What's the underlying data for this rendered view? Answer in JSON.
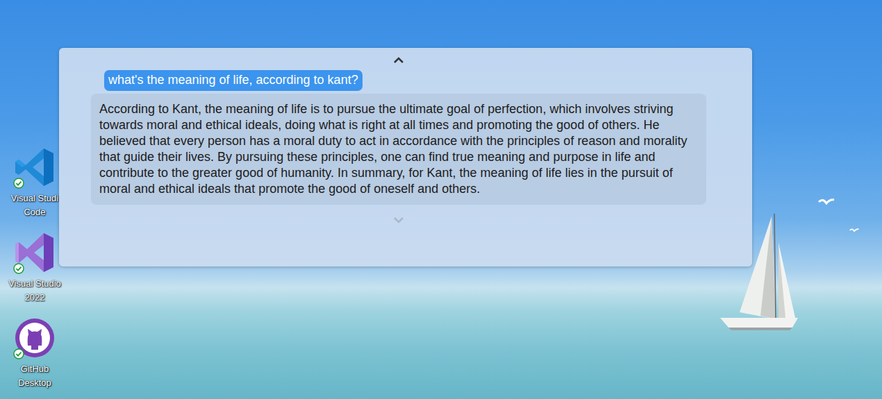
{
  "desktop_icons": [
    {
      "label": "Visual Studi Code",
      "synced": true
    },
    {
      "label": "Visual Studio 2022",
      "synced": true
    },
    {
      "label": "GitHub Desktop",
      "synced": true
    }
  ],
  "chat": {
    "messages": [
      {
        "kind": "user",
        "text": "what's the meaning of life, according to kant?"
      },
      {
        "kind": "assistant",
        "text": "According to Kant, the meaning of life is to pursue the ultimate goal of perfection, which involves striving towards moral and ethical ideals, doing what is right at all times and promoting the good of others. He believed that every person has a moral duty to act in accordance with the principles of reason and morality that guide their lives. By pursuing these principles, one can find true meaning and purpose in life and contribute to the greater good of humanity. In summary, for Kant, the meaning of life lies in the pursuit of moral and ethical ideals that promote the good of oneself and others."
      }
    ]
  }
}
